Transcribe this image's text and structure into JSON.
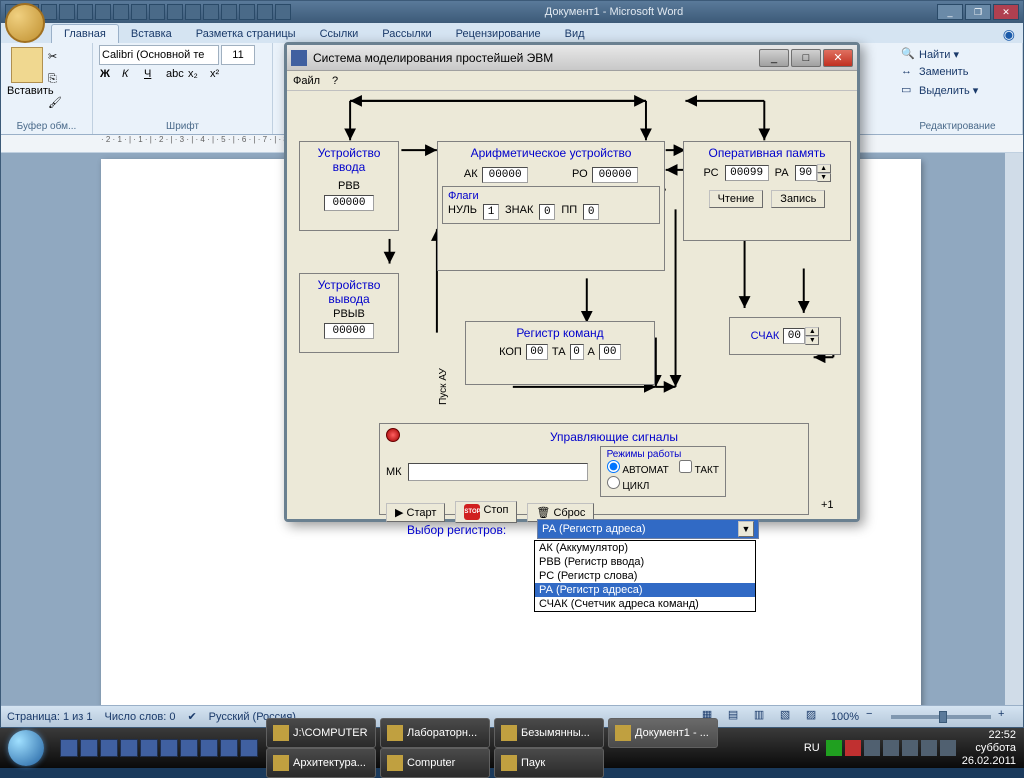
{
  "word": {
    "title": "Документ1 - Microsoft Word",
    "tabs": [
      "Главная",
      "Вставка",
      "Разметка страницы",
      "Ссылки",
      "Рассылки",
      "Рецензирование",
      "Вид"
    ],
    "paste": "Вставить",
    "clipboard_label": "Буфер обм...",
    "font_name": "Calibri (Основной те",
    "font_size": "11",
    "font_label": "Шрифт",
    "edit": {
      "find": "Найти ▾",
      "replace": "Заменить",
      "select": "Выделить ▾",
      "label": "Редактирование"
    },
    "status": {
      "page": "Страница: 1 из 1",
      "words": "Число слов: 0",
      "lang": "Русский (Россия)",
      "zoom": "100%"
    }
  },
  "sim": {
    "title": "Система моделирования простейшей ЭВМ",
    "menu": {
      "file": "Файл",
      "help": "?"
    },
    "input_dev": {
      "title": "Устройство ввода",
      "reg": "РВВ",
      "val": "00000"
    },
    "output_dev": {
      "title": "Устройство вывода",
      "reg": "РВЫВ",
      "val": "00000"
    },
    "alu": {
      "title": "Арифметическое устройство",
      "ak_label": "АК",
      "ak": "00000",
      "ro_label": "РО",
      "ro": "00000",
      "flags_label": "Флаги",
      "null_label": "НУЛЬ",
      "null": "1",
      "sign_label": "ЗНАК",
      "sign": "0",
      "pp_label": "ПП",
      "pp": "0"
    },
    "cmdreg": {
      "title": "Регистр команд",
      "kop_l": "КОП",
      "kop": "00",
      "ta_l": "ТА",
      "ta": "0",
      "a_l": "А",
      "a": "00"
    },
    "au_label": "Пуск АУ",
    "ram": {
      "title": "Оперативная память",
      "rs_l": "РС",
      "rs": "00099",
      "ra_l": "РА",
      "ra": "90",
      "read": "Чтение",
      "write": "Запись"
    },
    "schak": {
      "label": "СЧАК",
      "val": "00",
      "plus": "+1"
    },
    "ctrl": {
      "title": "Управляющие сигналы",
      "mk": "МК",
      "start": "Старт",
      "stop": "Стоп",
      "reset": "Сброс",
      "mode_label": "Режимы работы",
      "auto": "АВТОМАТ",
      "cycle": "ЦИКЛ",
      "tact": "ТАКТ"
    },
    "regsel": {
      "label": "Выбор регистров:",
      "value": "РА (Регистр адреса)",
      "options": [
        "АК (Аккумулятор)",
        "РВВ (Регистр ввода)",
        "РС (Регистр слова)",
        "РА (Регистр адреса)",
        "СЧАК (Счетчик адреса команд)"
      ]
    }
  },
  "taskbar": {
    "items": [
      "J:\\COMPUTER",
      "Лабораторн...",
      "Безымянны...",
      "Документ1 - ...",
      "Архитектура...",
      "Computer",
      "Паук"
    ],
    "lang": "RU",
    "time": "22:52",
    "day": "суббота",
    "date": "26.02.2011"
  }
}
